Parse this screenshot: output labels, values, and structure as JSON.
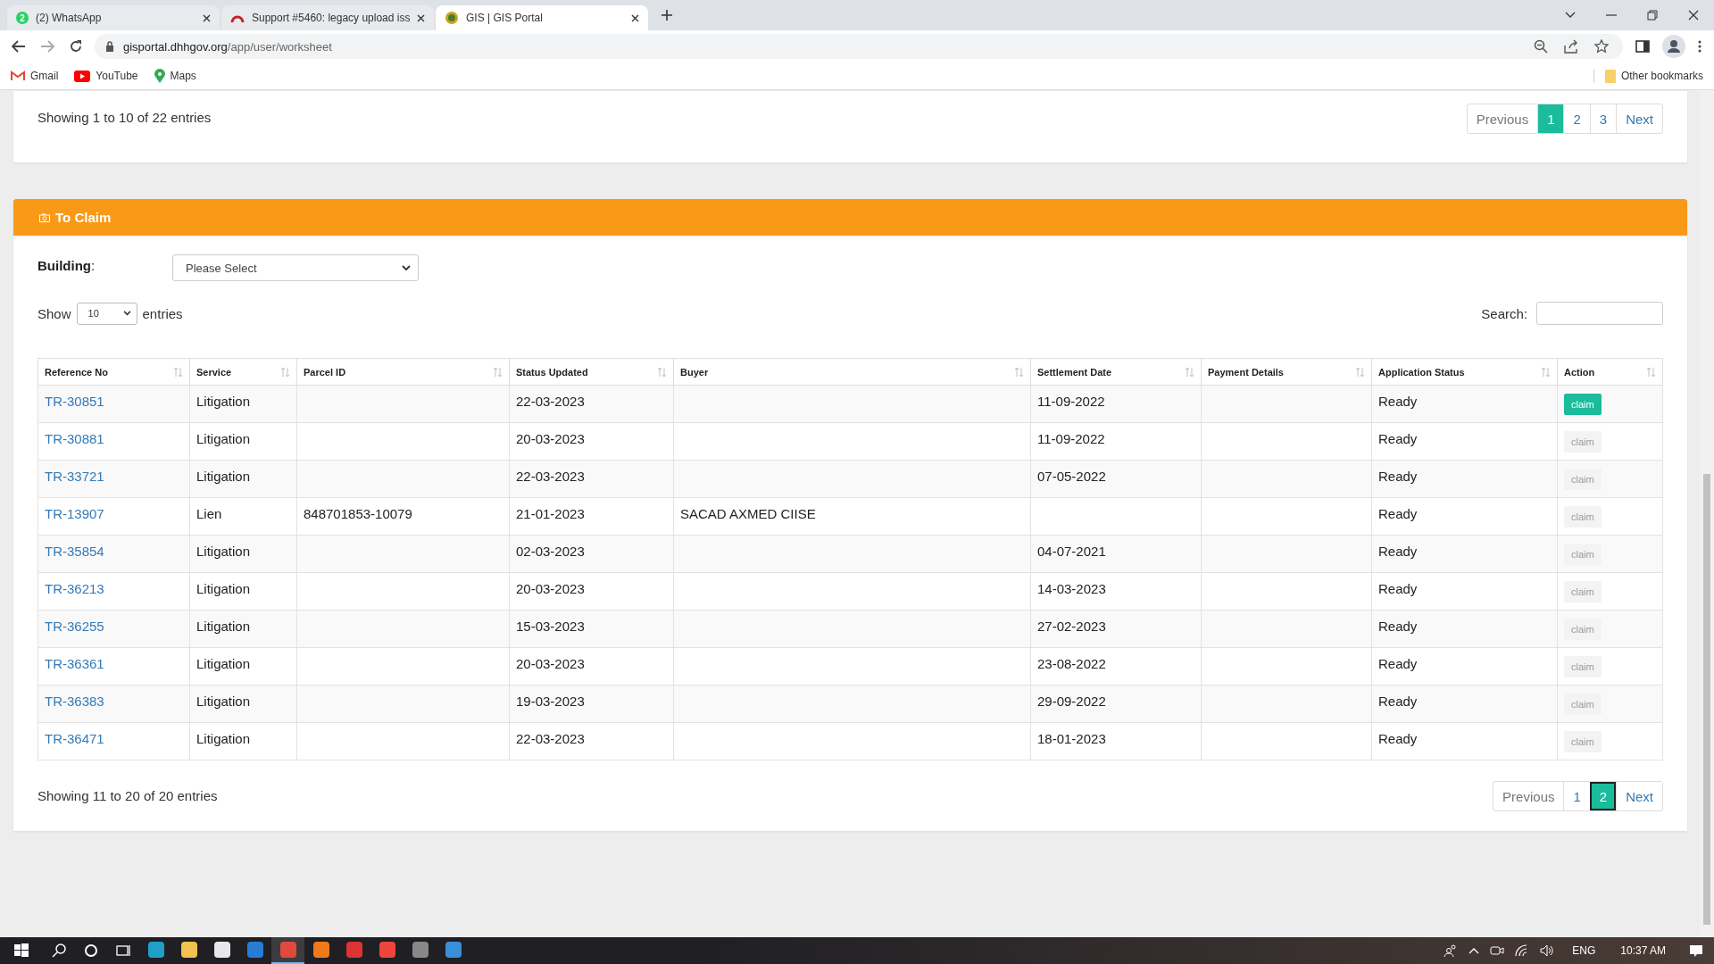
{
  "browser": {
    "tabs": [
      {
        "title": "(2) WhatsApp",
        "badge": "2",
        "kind": "whatsapp",
        "selected": false
      },
      {
        "title": "Support #5460: legacy upload iss",
        "kind": "support",
        "selected": false
      },
      {
        "title": "GIS | GIS Portal",
        "kind": "gis",
        "selected": true
      }
    ],
    "url_host": "gisportal.dhhgov.org",
    "url_path": "/app/user/worksheet",
    "bookmarks": [
      {
        "label": "Gmail",
        "kind": "gmail"
      },
      {
        "label": "YouTube",
        "kind": "youtube"
      },
      {
        "label": "Maps",
        "kind": "maps"
      }
    ],
    "other_bookmarks": "Other bookmarks"
  },
  "top_card": {
    "info": "Showing 1 to 10 of 22 entries",
    "pagination": [
      {
        "label": "Previous",
        "selected": false
      },
      {
        "label": "1",
        "selected": true
      },
      {
        "label": "2",
        "selected": false
      },
      {
        "label": "3",
        "selected": false
      },
      {
        "label": "Next",
        "selected": false
      }
    ]
  },
  "claim_panel": {
    "title": "To Claim",
    "building_label": "**Building**:",
    "building_select": "Please Select",
    "show_label": "Show",
    "show_value": "10",
    "entries_label": "entries",
    "search_label": "Search:",
    "columns": [
      "Reference No",
      "Service",
      "Parcel ID",
      "Status Updated",
      "Buyer",
      "Settlement Date",
      "Payment Details",
      "Application Status",
      "Action"
    ],
    "rows": [
      {
        "ref": "TR-30851",
        "service": "Litigation",
        "parcel": "",
        "status_updated": "22-03-2023",
        "buyer": "",
        "settlement": "11-09-2022",
        "payment": "",
        "app_status": "Ready",
        "action": "claim",
        "disabled": false
      },
      {
        "ref": "TR-30881",
        "service": "Litigation",
        "parcel": "",
        "status_updated": "20-03-2023",
        "buyer": "",
        "settlement": "11-09-2022",
        "payment": "",
        "app_status": "Ready",
        "action": "claim",
        "disabled": true
      },
      {
        "ref": "TR-33721",
        "service": "Litigation",
        "parcel": "",
        "status_updated": "22-03-2023",
        "buyer": "",
        "settlement": "07-05-2022",
        "payment": "",
        "app_status": "Ready",
        "action": "claim",
        "disabled": true
      },
      {
        "ref": "TR-13907",
        "service": "Lien",
        "parcel": "848701853-10079",
        "status_updated": "21-01-2023",
        "buyer": "SACAD AXMED CIISE",
        "settlement": "",
        "payment": "",
        "app_status": "Ready",
        "action": "claim",
        "disabled": true
      },
      {
        "ref": "TR-35854",
        "service": "Litigation",
        "parcel": "",
        "status_updated": "02-03-2023",
        "buyer": "",
        "settlement": "04-07-2021",
        "payment": "",
        "app_status": "Ready",
        "action": "claim",
        "disabled": true
      },
      {
        "ref": "TR-36213",
        "service": "Litigation",
        "parcel": "",
        "status_updated": "20-03-2023",
        "buyer": "",
        "settlement": "14-03-2023",
        "payment": "",
        "app_status": "Ready",
        "action": "claim",
        "disabled": true
      },
      {
        "ref": "TR-36255",
        "service": "Litigation",
        "parcel": "",
        "status_updated": "15-03-2023",
        "buyer": "",
        "settlement": "27-02-2023",
        "payment": "",
        "app_status": "Ready",
        "action": "claim",
        "disabled": true
      },
      {
        "ref": "TR-36361",
        "service": "Litigation",
        "parcel": "",
        "status_updated": "20-03-2023",
        "buyer": "",
        "settlement": "23-08-2022",
        "payment": "",
        "app_status": "Ready",
        "action": "claim",
        "disabled": true
      },
      {
        "ref": "TR-36383",
        "service": "Litigation",
        "parcel": "",
        "status_updated": "19-03-2023",
        "buyer": "",
        "settlement": "29-09-2022",
        "payment": "",
        "app_status": "Ready",
        "action": "claim",
        "disabled": true
      },
      {
        "ref": "TR-36471",
        "service": "Litigation",
        "parcel": "",
        "status_updated": "22-03-2023",
        "buyer": "",
        "settlement": "18-01-2023",
        "payment": "",
        "app_status": "Ready",
        "action": "claim",
        "disabled": true
      }
    ],
    "info": "Showing 11 to 20 of 20 entries",
    "pagination": [
      {
        "label": "Previous",
        "selected": false
      },
      {
        "label": "1",
        "selected": false
      },
      {
        "label": "2",
        "selected": true
      },
      {
        "label": "Next",
        "selected": false
      }
    ]
  },
  "taskbar": {
    "apps": [
      {
        "kind": "edge",
        "active": false
      },
      {
        "kind": "folder",
        "active": false
      },
      {
        "kind": "store",
        "active": false
      },
      {
        "kind": "mail",
        "active": false
      },
      {
        "kind": "chrome",
        "active": true
      },
      {
        "kind": "firefox",
        "active": false
      },
      {
        "kind": "snip",
        "active": false
      },
      {
        "kind": "anydesk",
        "active": false
      },
      {
        "kind": "scanner",
        "active": false
      },
      {
        "kind": "photos",
        "active": false
      }
    ],
    "language": "ENG",
    "time": "10:37 AM"
  }
}
